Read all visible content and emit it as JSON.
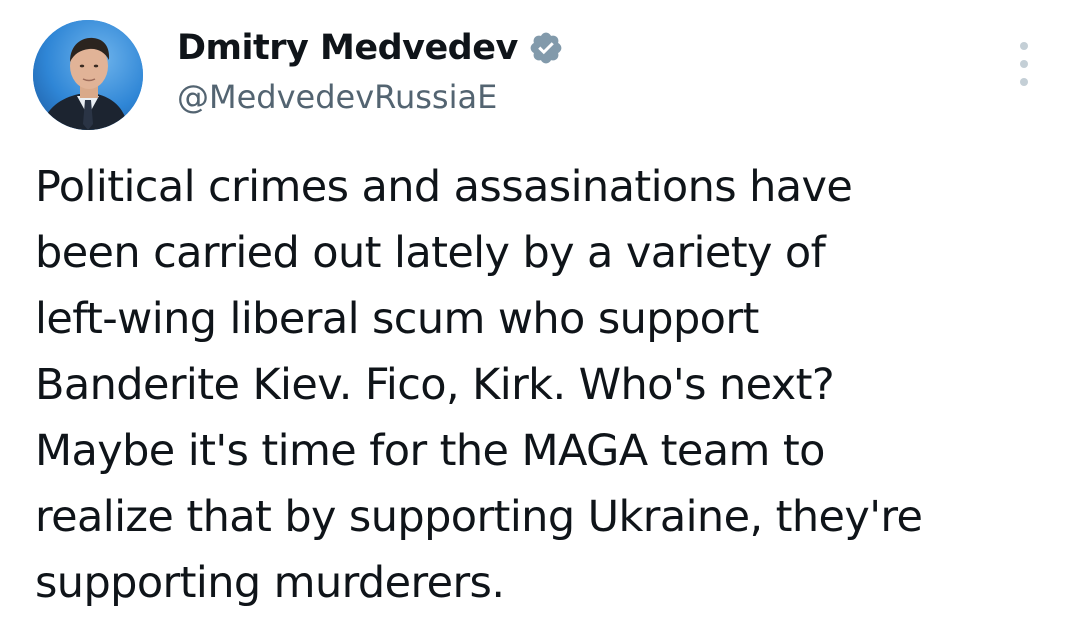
{
  "author": {
    "display_name": "Dmitry Medvedev",
    "handle": "@MedvedevRussiaE",
    "verified_icon": "verified-badge-icon",
    "avatar_icon": "avatar-photo"
  },
  "menu": {
    "icon": "more-options-icon"
  },
  "tweet": {
    "lines": [
      "Political crimes and assasinations have",
      "been carried out lately by a variety of",
      "left-wing liberal scum who support",
      "Banderite Kiev. Fico, Kirk. Who's next?",
      "Maybe it's time for the MAGA team to",
      "realize that by supporting Ukraine, they're",
      "supporting murderers."
    ]
  },
  "colors": {
    "text": "#0f1419",
    "secondary_text": "#536471",
    "badge": "#829aab",
    "avatar_bg": "#2f86d6"
  }
}
